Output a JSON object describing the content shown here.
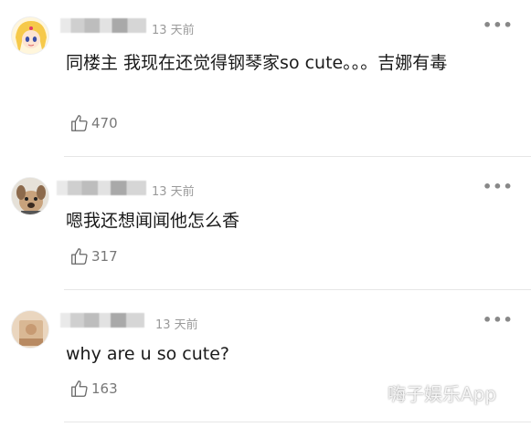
{
  "comments": [
    {
      "time": "13 天前",
      "text": "同楼主 我现在还觉得钢琴家so cute。。。吉娜有毒",
      "likes": "470",
      "avatar": "sailor-moon-avatar"
    },
    {
      "time": "13 天前",
      "text": "嗯我还想闻闻他怎么香",
      "likes": "317",
      "avatar": "dog-avatar"
    },
    {
      "time": "13 天前",
      "text": "why are u so cute?",
      "likes": "163",
      "avatar": "tan-avatar"
    }
  ],
  "more_label": "•••",
  "icons": {
    "like": "thumbs-up-icon",
    "more": "more-dots-icon"
  },
  "watermark": "嗨子娱乐App"
}
